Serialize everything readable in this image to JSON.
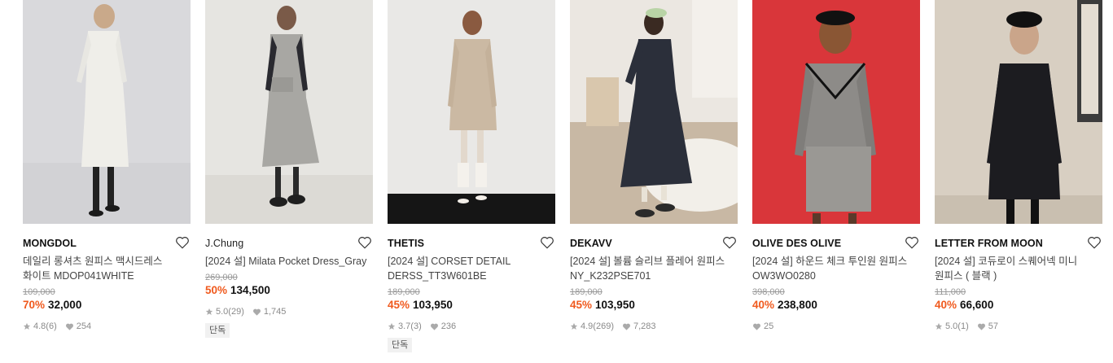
{
  "products": [
    {
      "brand": "MONGDOL",
      "name": "데일리 롱셔츠 원피스 맥시드레스 화이트 MDOP041WHITE",
      "original_price": "109,000",
      "discount": "70%",
      "price": "32,000",
      "rating": "4.8",
      "reviews": "(6)",
      "likes": "254",
      "badge": ""
    },
    {
      "brand": "J.Chung",
      "name": "[2024 설] Milata Pocket Dress_Gray",
      "original_price": "269,000",
      "discount": "50%",
      "price": "134,500",
      "rating": "5.0",
      "reviews": "(29)",
      "likes": "1,745",
      "badge": "단독"
    },
    {
      "brand": "THETIS",
      "name": "[2024 설] CORSET DETAIL DERSS_TT3W601BE",
      "original_price": "189,000",
      "discount": "45%",
      "price": "103,950",
      "rating": "3.7",
      "reviews": "(3)",
      "likes": "236",
      "badge": "단독"
    },
    {
      "brand": "DEKAVV",
      "name": "[2024 설] 볼륨 슬리브 플레어 원피스 NY_K232PSE701",
      "original_price": "189,000",
      "discount": "45%",
      "price": "103,950",
      "rating": "4.9",
      "reviews": "(269)",
      "likes": "7,283",
      "badge": ""
    },
    {
      "brand": "OLIVE DES OLIVE",
      "name": "[2024 설] 하운드 체크 투인원 원피스 OW3WO0280",
      "original_price": "398,000",
      "discount": "40%",
      "price": "238,800",
      "rating": "",
      "reviews": "",
      "likes": "25",
      "badge": ""
    },
    {
      "brand": "LETTER FROM MOON",
      "name": "[2024 설] 코듀로이 스퀘어넥 미니 원피스 ( 블랙 )",
      "original_price": "111,000",
      "discount": "40%",
      "price": "66,600",
      "rating": "5.0",
      "reviews": "(1)",
      "likes": "57",
      "badge": ""
    }
  ],
  "colors": {
    "discount": "#f05a1e",
    "muted": "#999999"
  },
  "icons": {
    "wishlist": "heart-outline-icon",
    "rating": "star-icon",
    "likes": "heart-filled-icon"
  }
}
